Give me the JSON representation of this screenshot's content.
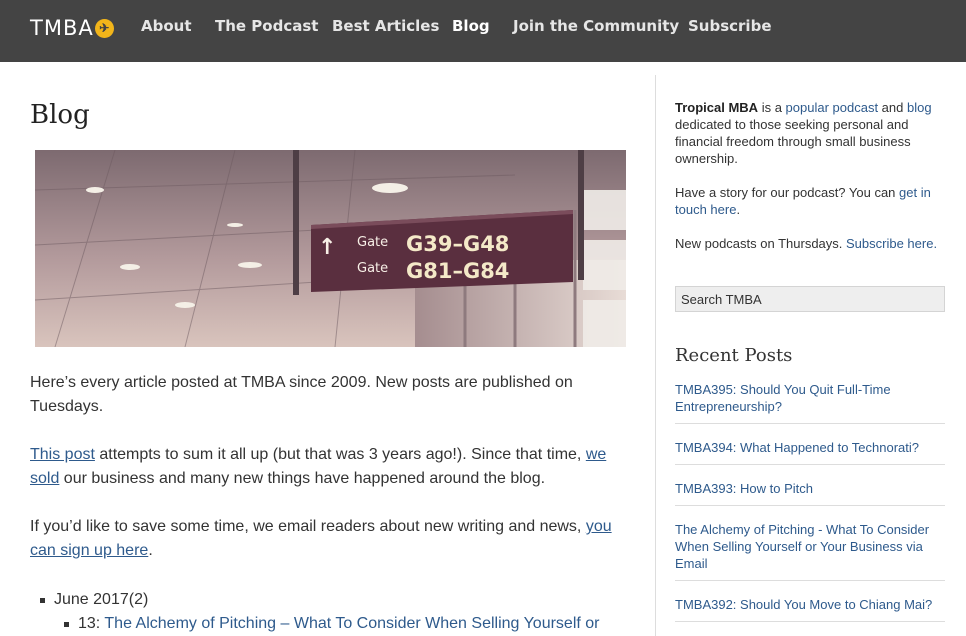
{
  "site": {
    "logo_text": "TMBA",
    "logo_badge_icon": "airplane-icon"
  },
  "nav": {
    "items": [
      {
        "label": "About"
      },
      {
        "label": "The Podcast"
      },
      {
        "label": "Best Articles"
      },
      {
        "label": "Blog",
        "active": true
      },
      {
        "label": "Join the Community"
      },
      {
        "label": "Subscribe"
      }
    ]
  },
  "main": {
    "title": "Blog",
    "hero_sign": {
      "gate_word_1": "Gate",
      "gate_range_1": "G39–G48",
      "gate_word_2": "Gate",
      "gate_range_2": "G81–G84"
    },
    "intro": "Here’s every article posted at TMBA since 2009.  New posts are published on Tuesdays.",
    "para2": {
      "link1": "This post",
      "text1": " attempts to sum it all up (but that was 3 years ago!). Since that time, ",
      "link2": "we sold",
      "text2": " our business and many new things have happened around the blog."
    },
    "para3": {
      "text1": "If you’d like to save some time, we email readers about new writing and news, ",
      "link1": "you can sign up here",
      "text2": "."
    },
    "archive": {
      "month": "June 2017(2)",
      "post_number": "13:",
      "post_title": "The Alchemy of Pitching – What To Consider When Selling Yourself or"
    }
  },
  "sidebar": {
    "about": {
      "brand": "Tropical MBA",
      "t1": " is a ",
      "link_podcast": "popular podcast",
      "t2": " and ",
      "link_blog": "blog",
      "t3": " dedicated to those seeking personal and financial freedom through small business ownership."
    },
    "story": {
      "text": "Have a story for our podcast? You can ",
      "link": "get in touch here",
      "end": "."
    },
    "podcasts": {
      "text": "New podcasts on Thursdays. ",
      "link": "Subscribe here."
    },
    "search_placeholder": "Search TMBA",
    "recent_title": "Recent Posts",
    "recent_posts": [
      "TMBA395: Should You Quit Full-Time Entrepreneurship?",
      "TMBA394: What Happened to Technorati?",
      "TMBA393: How to Pitch",
      "The Alchemy of Pitching - What To Consider When Selling Yourself or Your Business via Email",
      "TMBA392: Should You Move to Chiang Mai?"
    ]
  },
  "colors": {
    "nav_bg": "#444444",
    "link": "#2e5a8c",
    "logo_badge": "#f2b51a"
  }
}
